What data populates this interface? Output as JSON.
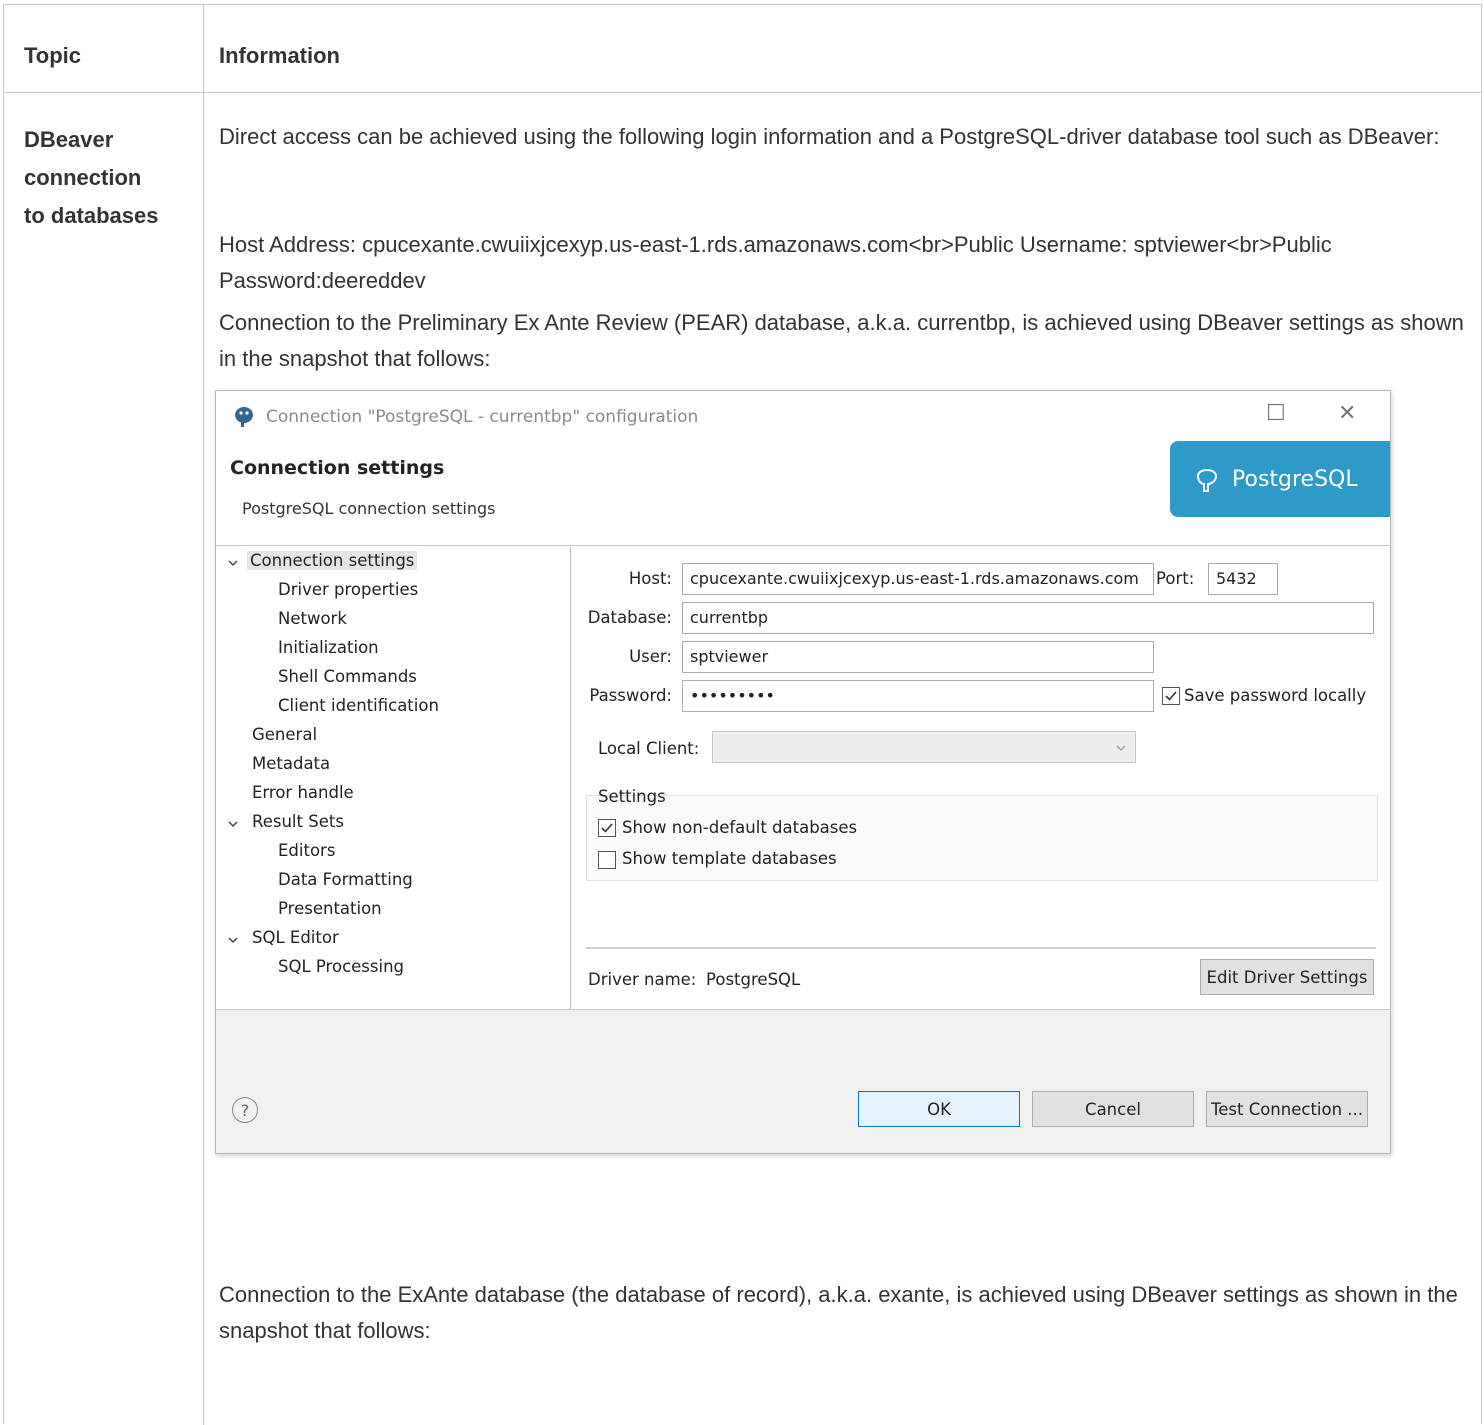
{
  "table": {
    "header": {
      "topic": "Topic",
      "information": "Information"
    },
    "row": {
      "topic_lines": [
        "DBeaver",
        "connection",
        "to databases"
      ],
      "paragraphs": [
        "Direct access can be achieved using the following login information and a PostgreSQL-driver database tool such as DBeaver:",
        "Host Address: cpucexante.cwuiixjcexyp.us-east-1.rds.amazonaws.com<br>Public Username: sptviewer<br>Public Password:deereddev",
        "Connection to the Preliminary Ex Ante Review (PEAR) database, a.k.a. currentbp, is achieved using DBeaver settings as shown in the snapshot that follows:",
        "Connection to the ExAnte database (the database of record), a.k.a. exante, is achieved using DBeaver settings as shown in the snapshot that follows:"
      ]
    }
  },
  "dialog": {
    "window_title": "Connection \"PostgreSQL - currentbp\" configuration",
    "header_title": "Connection settings",
    "header_subtitle": "PostgreSQL connection settings",
    "banner_text": "PostgreSQL",
    "icons": {
      "app": "postgres-elephant-icon",
      "maximize": "maximize-icon",
      "close": "close-icon",
      "help": "help-icon"
    },
    "tree": [
      {
        "label": "Connection settings",
        "level": 0,
        "expanded": true,
        "selected": true
      },
      {
        "label": "Driver properties",
        "level": 1
      },
      {
        "label": "Network",
        "level": 1
      },
      {
        "label": "Initialization",
        "level": 1
      },
      {
        "label": "Shell Commands",
        "level": 1
      },
      {
        "label": "Client identification",
        "level": 1
      },
      {
        "label": "General",
        "level": 0
      },
      {
        "label": "Metadata",
        "level": 0
      },
      {
        "label": "Error handle",
        "level": 0
      },
      {
        "label": "Result Sets",
        "level": 0,
        "expanded": true
      },
      {
        "label": "Editors",
        "level": 1
      },
      {
        "label": "Data Formatting",
        "level": 1
      },
      {
        "label": "Presentation",
        "level": 1
      },
      {
        "label": "SQL Editor",
        "level": 0,
        "expanded": true
      },
      {
        "label": "SQL Processing",
        "level": 1
      }
    ],
    "form": {
      "host_label": "Host:",
      "host_value": "cpucexante.cwuiixjcexyp.us-east-1.rds.amazonaws.com",
      "port_label": "Port:",
      "port_value": "5432",
      "database_label": "Database:",
      "database_value": "currentbp",
      "user_label": "User:",
      "user_value": "sptviewer",
      "password_label": "Password:",
      "password_value": "•••••••••",
      "save_password_label": "Save password locally",
      "save_password_checked": true,
      "local_client_label": "Local Client:",
      "local_client_value": "",
      "settings_group_label": "Settings",
      "show_non_default_label": "Show non-default databases",
      "show_non_default_checked": true,
      "show_template_label": "Show template databases",
      "show_template_checked": false,
      "driver_name_label": "Driver name:",
      "driver_name_value": "PostgreSQL",
      "edit_driver_label": "Edit Driver Settings"
    },
    "buttons": {
      "ok": "OK",
      "cancel": "Cancel",
      "test": "Test Connection ..."
    },
    "help_glyph": "?"
  }
}
